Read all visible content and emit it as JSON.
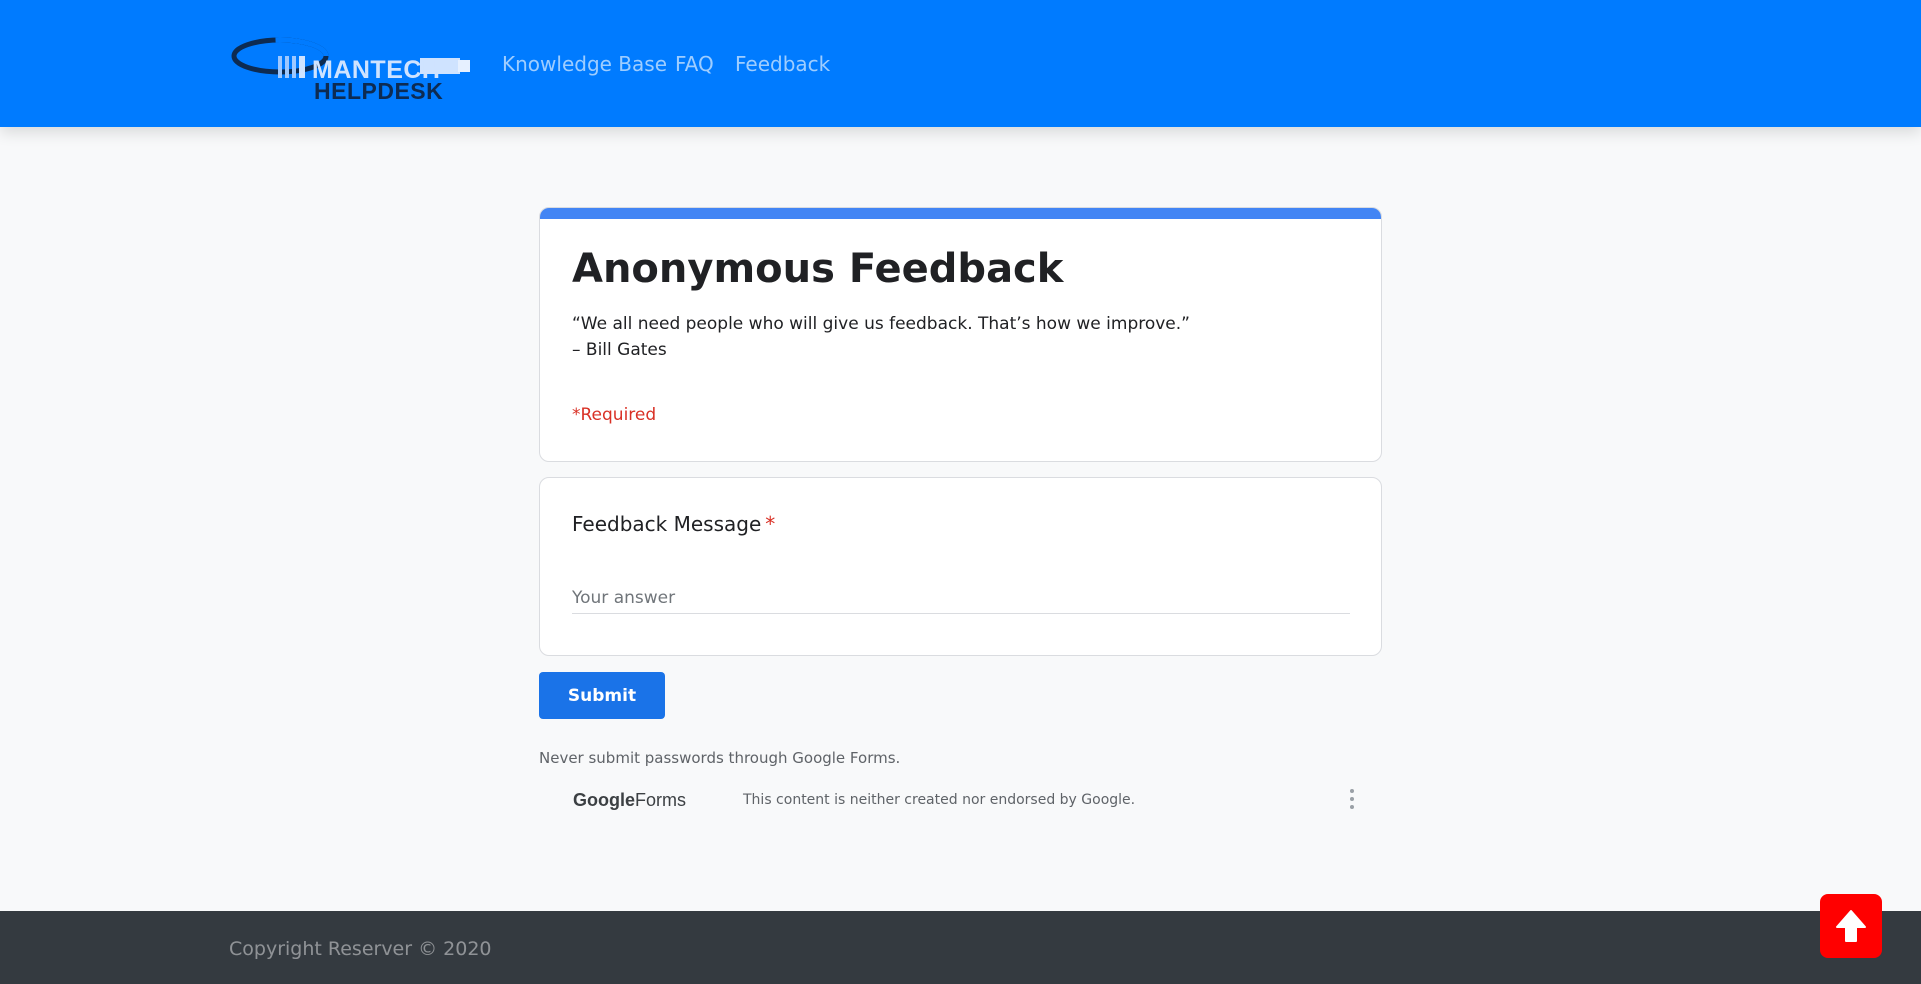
{
  "header": {
    "brand": {
      "line1": "MANTECH",
      "line2": "HELPDESK"
    },
    "nav": [
      {
        "label": "Knowledge Base"
      },
      {
        "label": "FAQ"
      },
      {
        "label": "Feedback"
      }
    ]
  },
  "form": {
    "title": "Anonymous Feedback",
    "quote": "“We all need people who will give us feedback. That’s how we improve.”",
    "author": "– Bill Gates",
    "required_note": "*Required",
    "question": {
      "label": "Feedback Message",
      "required_mark": "*",
      "placeholder": "Your answer",
      "value": ""
    },
    "submit_label": "Submit",
    "disclaimer": "Never submit passwords through Google Forms.",
    "google_forms": {
      "logo_google": "Google",
      "logo_forms": "Forms",
      "notice": "This content is neither created nor endorsed by Google."
    }
  },
  "footer": {
    "copyright": "Copyright Reserver © 2020"
  },
  "icons": {
    "scroll_top": "arrow-up-icon",
    "menu": "more-vert-icon",
    "logo": "helpdesk-logo"
  },
  "colors": {
    "navbar": "#007bff",
    "form_accent": "#4285f4",
    "submit": "#1a73e8",
    "required": "#d93025",
    "footer": "#343a40",
    "scroll_top": "#ff0000"
  }
}
